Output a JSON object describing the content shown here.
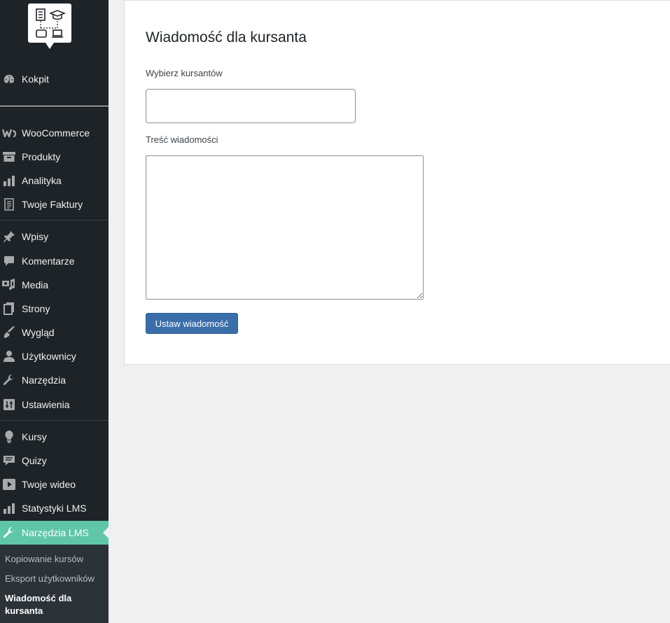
{
  "sidebar": {
    "top_items": [
      {
        "label": "Kokpit",
        "icon": "dashboard-icon"
      }
    ],
    "shop_items": [
      {
        "label": "WooCommerce",
        "icon": "woocommerce-icon"
      },
      {
        "label": "Produkty",
        "icon": "archive-icon"
      },
      {
        "label": "Analityka",
        "icon": "bar-chart-icon"
      },
      {
        "label": "Twoje Faktury",
        "icon": "document-icon"
      }
    ],
    "content_items": [
      {
        "label": "Wpisy",
        "icon": "pin-icon"
      },
      {
        "label": "Komentarze",
        "icon": "comment-icon"
      },
      {
        "label": "Media",
        "icon": "media-icon"
      },
      {
        "label": "Strony",
        "icon": "pages-icon"
      },
      {
        "label": "Wygląd",
        "icon": "brush-icon"
      },
      {
        "label": "Użytkownicy",
        "icon": "user-icon"
      },
      {
        "label": "Narzędzia",
        "icon": "wrench-icon"
      },
      {
        "label": "Ustawienia",
        "icon": "settings-icon"
      }
    ],
    "lms_items": [
      {
        "label": "Kursy",
        "icon": "lightbulb-icon"
      },
      {
        "label": "Quizy",
        "icon": "quiz-icon"
      },
      {
        "label": "Twoje wideo",
        "icon": "play-icon"
      },
      {
        "label": "Statystyki LMS",
        "icon": "bar-chart-icon"
      },
      {
        "label": "Narzędzia LMS",
        "icon": "wrench-icon",
        "active": true
      }
    ],
    "submenu": [
      {
        "label": "Kopiowanie kursów"
      },
      {
        "label": "Eksport użytkowników"
      },
      {
        "label": "Wiadomość dla kursanta",
        "current": true
      }
    ]
  },
  "main": {
    "title": "Wiadomość dla kursanta",
    "students_label": "Wybierz kursantów",
    "students_value": "",
    "message_label": "Treść wiadomości",
    "message_value": "",
    "submit_label": "Ustaw wiadomość"
  },
  "colors": {
    "sidebar_bg": "#1d2327",
    "active_bg": "#5fc7a8",
    "button_bg": "#3a6ea8"
  }
}
